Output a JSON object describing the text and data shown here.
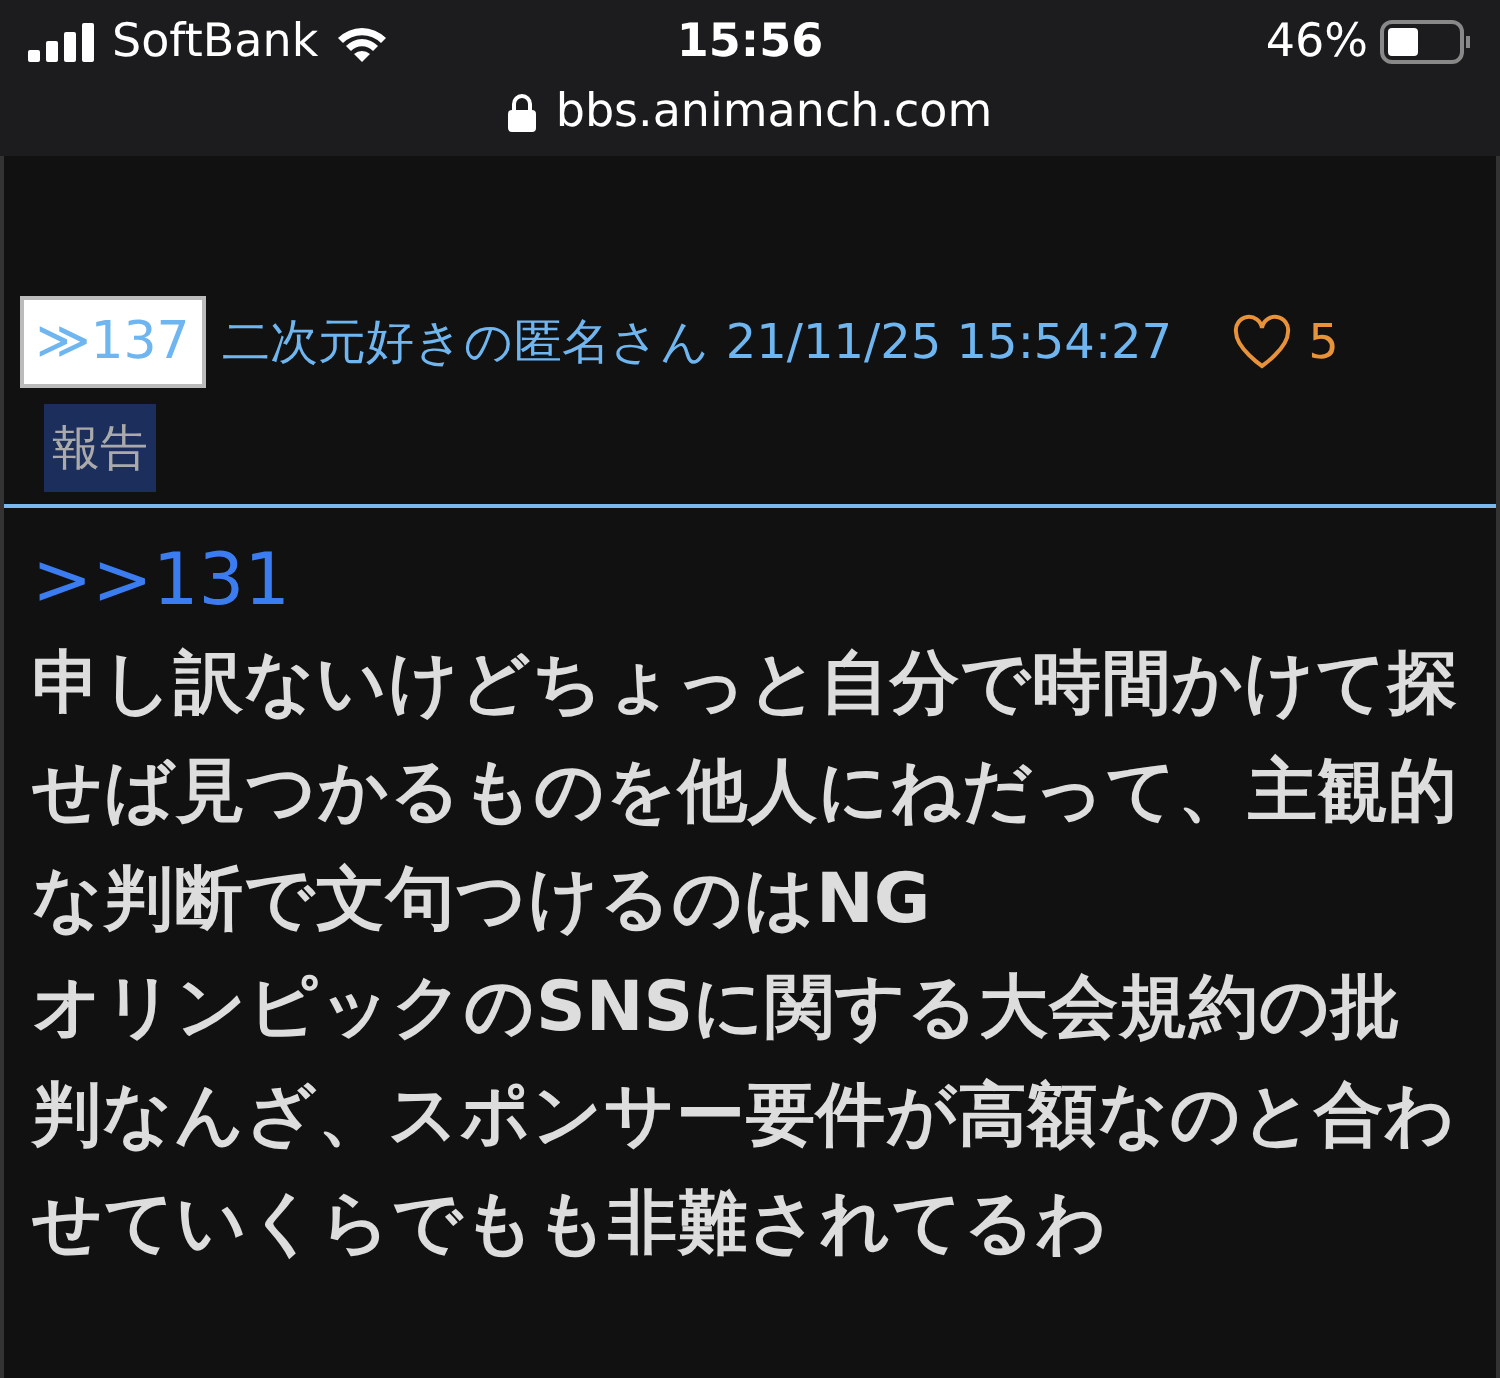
{
  "status_bar": {
    "carrier": "SoftBank",
    "time": "15:56",
    "battery": "46%"
  },
  "address_bar": {
    "url": "bbs.animanch.com"
  },
  "post": {
    "number": "≫137",
    "author": "二次元好きの匿名さん",
    "timestamp": "21/11/25 15:54:27",
    "likes": "5",
    "report_label": "報告",
    "reply_to": ">>131",
    "body_lines": [
      "申し訳ないけどちょっと自分で時間かけて探",
      "せば見つかるものを他人にねだって、主観的",
      "な判断で文句つけるのはNG",
      "オリンピックのSNSに関する大会規約の批",
      "判なんざ、スポンサー要件が高額なのと合わ",
      "せていくらでもも非難されてるわ"
    ]
  }
}
